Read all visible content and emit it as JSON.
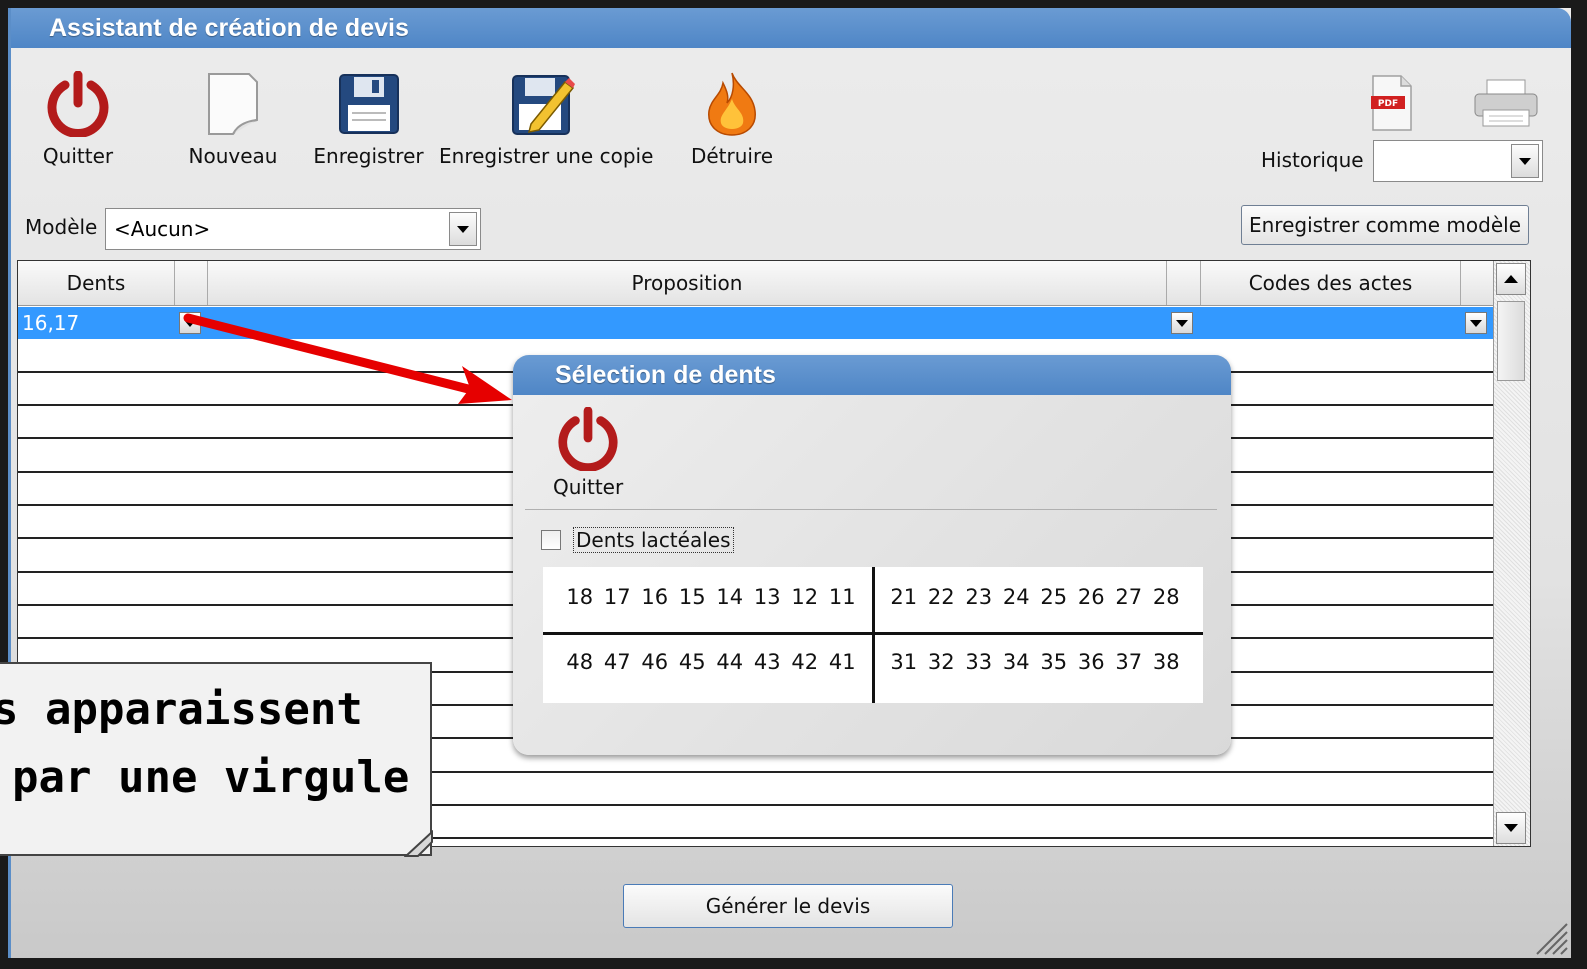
{
  "window": {
    "title": "Assistant de création de devis"
  },
  "toolbar": {
    "quit_label": "Quitter",
    "new_label": "Nouveau",
    "save_label": "Enregistrer",
    "save_copy_label": "Enregistrer une copie",
    "destroy_label": "Détruire"
  },
  "history": {
    "label": "Historique",
    "value": ""
  },
  "model": {
    "label": "Modèle",
    "value": "<Aucun>",
    "save_as_model_label": "Enregistrer comme modèle"
  },
  "table": {
    "columns": [
      "Dents",
      "Proposition",
      "Codes des actes"
    ],
    "selected_row": {
      "dents": "16,17",
      "proposition": "",
      "codes": ""
    }
  },
  "generate_label": "Générer le devis",
  "popup": {
    "title": "Sélection de dents",
    "quit_label": "Quitter",
    "milk_teeth_label": "Dents lactéales",
    "upper_right": [
      "18",
      "17",
      "16",
      "15",
      "14",
      "13",
      "12",
      "11"
    ],
    "upper_left": [
      "21",
      "22",
      "23",
      "24",
      "25",
      "26",
      "27",
      "28"
    ],
    "lower_right": [
      "48",
      "47",
      "46",
      "45",
      "44",
      "43",
      "42",
      "41"
    ],
    "lower_left": [
      "31",
      "32",
      "33",
      "34",
      "35",
      "36",
      "37",
      "38"
    ]
  },
  "callout": {
    "line1": "s apparaissent",
    "line2": "par une virgule"
  },
  "colors": {
    "titlebar": "#5b8ec8",
    "selection": "#3399ff",
    "arrow": "#e60000",
    "power_icon": "#b31b1b"
  }
}
